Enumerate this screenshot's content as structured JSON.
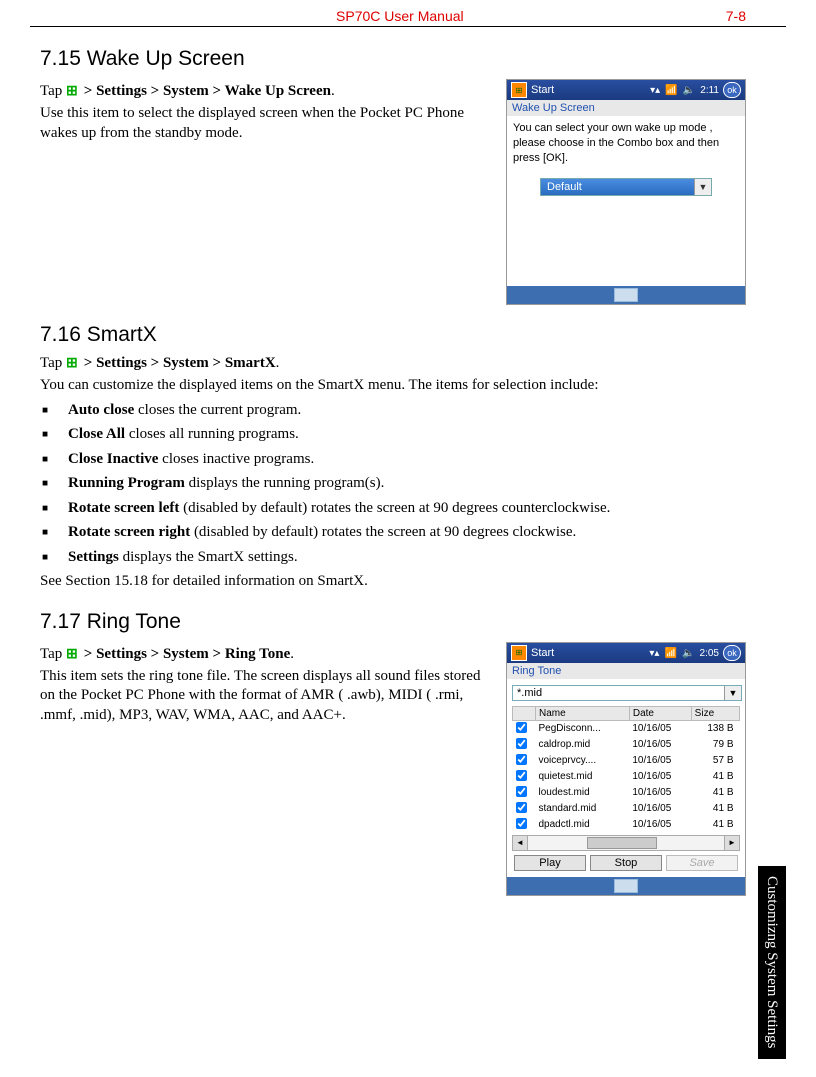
{
  "header": {
    "title": "SP70C User Manual",
    "page": "7-8"
  },
  "side_tab": "Customizng System Settings",
  "sec715": {
    "heading": "7.15    Wake Up Screen",
    "tap_prefix": "Tap ",
    "tap_path": " > Settings > System > Wake Up Screen",
    "tap_suffix": ".",
    "body": "Use this item to select the displayed screen when the Pocket PC Phone wakes up from the standby mode."
  },
  "sec716": {
    "heading": "7.16    SmartX",
    "tap_prefix": "Tap ",
    "tap_path": " > Settings > System > SmartX",
    "tap_suffix": ".",
    "intro": "You can customize the displayed items on the SmartX menu. The items for selection include:",
    "items": [
      {
        "name": "Auto close",
        "desc": "  closes the current program."
      },
      {
        "name": "Close All",
        "desc": "  closes all running programs."
      },
      {
        "name": "Close Inactive",
        "desc": "  closes inactive programs."
      },
      {
        "name": "Running Program",
        "desc": "  displays the running program(s)."
      },
      {
        "name": "Rotate screen left",
        "desc": "  (disabled by default) rotates the screen at 90 degrees counterclockwise."
      },
      {
        "name": "Rotate screen right",
        "desc": "  (disabled by default) rotates the screen at 90 degrees clockwise."
      },
      {
        "name": "Settings",
        "desc": "  displays the SmartX settings."
      }
    ],
    "after": "See Section 15.18 for detailed information on SmartX."
  },
  "sec717": {
    "heading": "7.17    Ring Tone",
    "tap_prefix": "Tap ",
    "tap_path": " > Settings > System > Ring Tone",
    "tap_suffix": ".",
    "body": "This item sets the ring tone file. The screen displays all sound files stored on the Pocket PC Phone with the format of AMR ( .awb), MIDI ( .rmi, .mmf, .mid), MP3, WAV, WMA, AAC, and AAC+."
  },
  "device1": {
    "start": "Start",
    "time": "2:11",
    "ok": "ok",
    "subtitle": "Wake Up Screen",
    "text": "You can select your own wake up mode , please choose in the Combo box and then press [OK].",
    "combo": "Default"
  },
  "device2": {
    "start": "Start",
    "time": "2:05",
    "ok": "ok",
    "subtitle": "Ring Tone",
    "filter": "*.mid",
    "columns": {
      "name": "Name",
      "date": "Date",
      "size": "Size"
    },
    "files": [
      {
        "n": "PegDisconn...",
        "d": "10/16/05",
        "s": "138 B"
      },
      {
        "n": "caldrop.mid",
        "d": "10/16/05",
        "s": "79 B"
      },
      {
        "n": "voiceprvcy....",
        "d": "10/16/05",
        "s": "57 B"
      },
      {
        "n": "quietest.mid",
        "d": "10/16/05",
        "s": "41 B"
      },
      {
        "n": "loudest.mid",
        "d": "10/16/05",
        "s": "41 B"
      },
      {
        "n": "standard.mid",
        "d": "10/16/05",
        "s": "41 B"
      },
      {
        "n": "dpadctl.mid",
        "d": "10/16/05",
        "s": "41 B"
      }
    ],
    "buttons": {
      "play": "Play",
      "stop": "Stop",
      "save": "Save"
    }
  }
}
